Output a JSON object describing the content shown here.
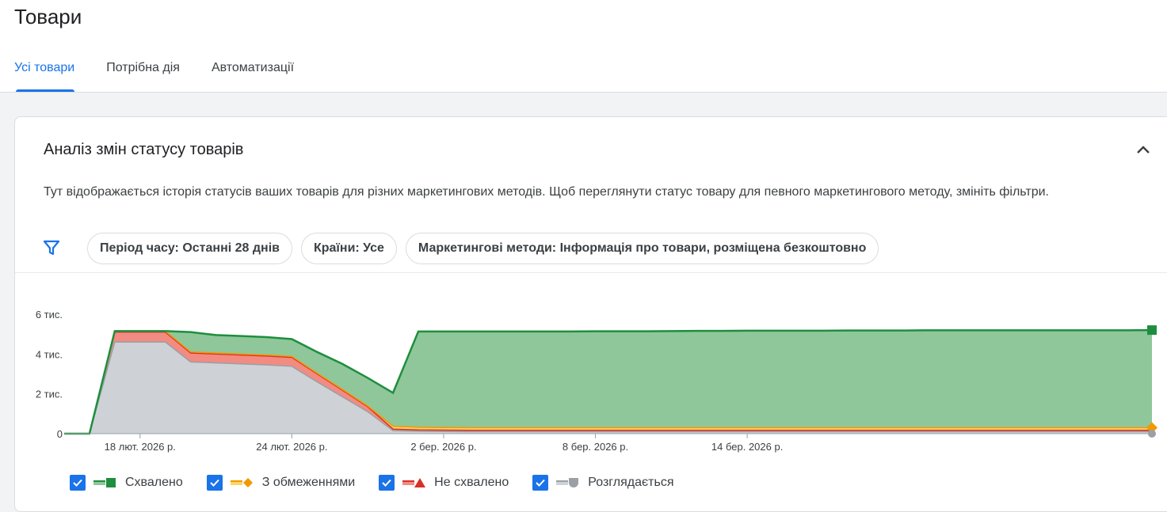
{
  "header": {
    "title": "Товари"
  },
  "tabs": [
    {
      "label": "Усі товари",
      "active": true
    },
    {
      "label": "Потрібна дія",
      "active": false
    },
    {
      "label": "Автоматизації",
      "active": false
    }
  ],
  "card": {
    "title": "Аналіз змін статусу товарів",
    "description": "Тут відображається історія статусів ваших товарів для різних маркетингових методів. Щоб переглянути статус товару для певного маркетингового методу, змініть фільтри.",
    "collapse_icon": "chevron-up-icon",
    "filter_icon": "filter-icon",
    "chips": [
      "Період часу: Останні 28 днів",
      "Країни: Усе",
      "Маркетингові методи: Інформація про товари, розміщена безкоштовно"
    ]
  },
  "colors": {
    "approved": "#1e8e3e",
    "approved_fill": "#8fc79a",
    "limited": "#f29900",
    "not_approved": "#d93025",
    "not_approved_fill": "#f28b82",
    "pending": "#9aa0a6",
    "pending_fill": "#ced2d6",
    "accent": "#1a73e8"
  },
  "chart_data": {
    "type": "area",
    "stacked": true,
    "y_ticks": [
      "0",
      "2 тис.",
      "4 тис.",
      "6 тис."
    ],
    "ylim": [
      0,
      6000
    ],
    "x_ticks": [
      "18 лют. 2026 р.",
      "24 лют. 2026 р.",
      "2 бер. 2026 р.",
      "8 бер. 2026 р.",
      "14 бер. 2026 р."
    ],
    "x_dates": [
      "15 лют.",
      "16 лют.",
      "17 лют.",
      "18 лют.",
      "19 лют.",
      "20 лют.",
      "21 лют.",
      "22 лют.",
      "23 лют.",
      "24 лют.",
      "25 лют.",
      "26 лют.",
      "27 лют.",
      "28 лют.",
      "1 бер.",
      "2 бер.",
      "3 бер.",
      "4 бер.",
      "5 бер.",
      "6 бер.",
      "7 бер.",
      "8 бер.",
      "9 бер.",
      "10 бер.",
      "11 бер.",
      "12 бер.",
      "13 бер.",
      "14 бер.",
      "15 бер.",
      "16 бер.",
      "17 бер.",
      "18 бер.",
      "19 бер.",
      "20 бер.",
      "21 бер.",
      "22 бер.",
      "23 бер.",
      "24 бер.",
      "25 бер.",
      "26 бер.",
      "27 бер.",
      "28 бер.",
      "29 бер.",
      "30 бер."
    ],
    "series": [
      {
        "name": "Розглядається",
        "key": "pending"
      },
      {
        "name": "Не схвалено",
        "key": "not_approved"
      },
      {
        "name": "З обмеженнями",
        "key": "limited"
      },
      {
        "name": "Схвалено",
        "key": "approved"
      }
    ],
    "total": [
      0,
      0,
      5150,
      5150,
      5150,
      5100,
      4950,
      4900,
      4850,
      4750,
      4100,
      3500,
      2800,
      2050,
      5130,
      5130,
      5130,
      5130,
      5130,
      5130,
      5130,
      5140,
      5140,
      5140,
      5150,
      5160,
      5160,
      5170,
      5170,
      5170,
      5170,
      5180,
      5180,
      5180,
      5190,
      5190,
      5190,
      5190,
      5190,
      5190,
      5190,
      5190,
      5190,
      5200
    ],
    "pending": [
      0,
      0,
      4600,
      4600,
      4600,
      3600,
      3550,
      3500,
      3450,
      3380,
      2600,
      1850,
      1100,
      150,
      120,
      110,
      100,
      100,
      100,
      100,
      100,
      100,
      100,
      100,
      100,
      100,
      100,
      100,
      100,
      100,
      100,
      100,
      100,
      100,
      100,
      100,
      100,
      100,
      100,
      100,
      100,
      100,
      100,
      100
    ],
    "not_approved": [
      0,
      0,
      500,
      500,
      500,
      450,
      450,
      450,
      450,
      450,
      400,
      330,
      250,
      80,
      70,
      70,
      70,
      70,
      70,
      70,
      70,
      70,
      70,
      70,
      70,
      70,
      70,
      70,
      70,
      70,
      70,
      70,
      70,
      70,
      70,
      70,
      70,
      70,
      70,
      70,
      70,
      70,
      70,
      70
    ],
    "limited": [
      0,
      0,
      50,
      50,
      50,
      50,
      50,
      50,
      50,
      50,
      40,
      40,
      40,
      140,
      130,
      130,
      130,
      130,
      130,
      130,
      130,
      130,
      130,
      130,
      130,
      130,
      130,
      130,
      130,
      130,
      130,
      130,
      130,
      130,
      130,
      130,
      130,
      130,
      130,
      130,
      130,
      130,
      130,
      130
    ]
  },
  "legend": [
    {
      "label": "Схвалено",
      "icon": "approved-square-icon",
      "checked": true
    },
    {
      "label": "З обмеженнями",
      "icon": "limited-diamond-icon",
      "checked": true
    },
    {
      "label": "Не схвалено",
      "icon": "not-approved-triangle-icon",
      "checked": true
    },
    {
      "label": "Розглядається",
      "icon": "pending-circle-icon",
      "checked": true
    }
  ]
}
